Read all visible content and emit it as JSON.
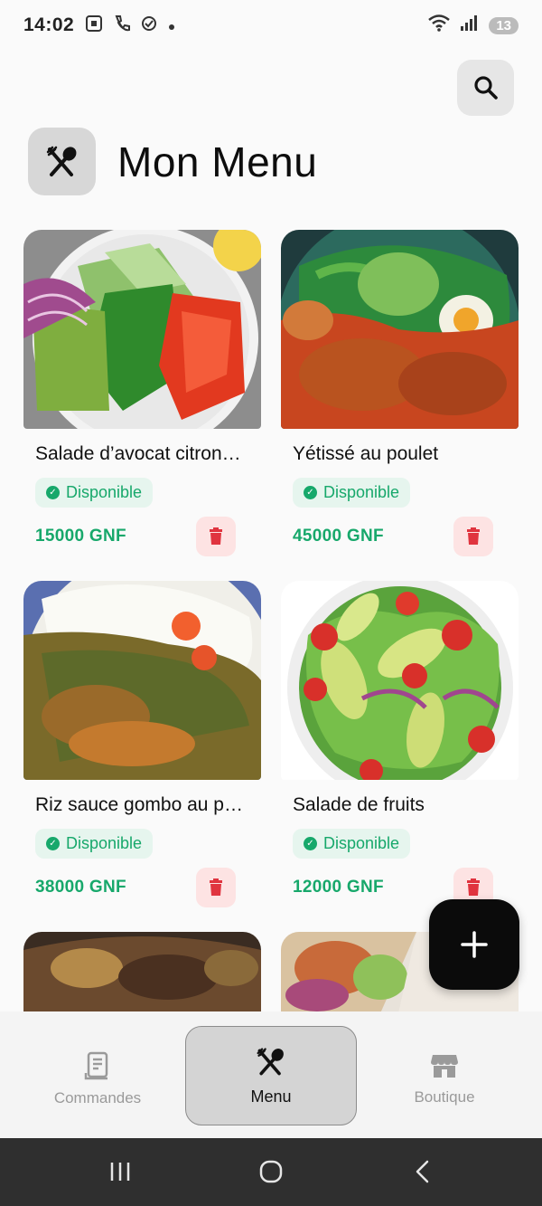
{
  "status_bar": {
    "time": "14:02",
    "battery": "13"
  },
  "header": {
    "title": "Mon Menu"
  },
  "menu_items": [
    {
      "name": "Salade d’avocat citron…",
      "status": "Disponible",
      "price": "15000 GNF"
    },
    {
      "name": "Yétissé au poulet",
      "status": "Disponible",
      "price": "45000 GNF"
    },
    {
      "name": "Riz sauce gombo au p…",
      "status": "Disponible",
      "price": "38000 GNF"
    },
    {
      "name": "Salade de fruits",
      "status": "Disponible",
      "price": "12000 GNF"
    }
  ],
  "bottom_nav": {
    "items": [
      {
        "label": "Commandes",
        "icon": "receipt-icon"
      },
      {
        "label": "Menu",
        "icon": "utensils-icon"
      },
      {
        "label": "Boutique",
        "icon": "store-icon"
      }
    ]
  },
  "colors": {
    "accent_green": "#17a86b",
    "delete_red": "#e0343f",
    "fab": "#0b0b0b"
  }
}
